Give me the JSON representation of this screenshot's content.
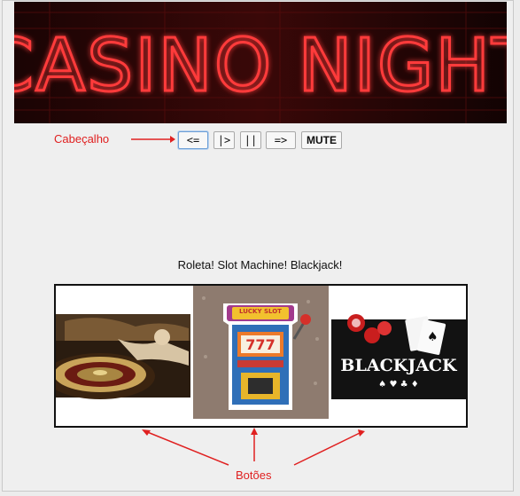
{
  "banner": {
    "title": "Casino Night",
    "logo_text": "CASINO NIGHT"
  },
  "annotations": {
    "header_label": "Cabeçalho",
    "buttons_label": "Botões"
  },
  "toolbar": {
    "prev_label": "<=",
    "play_label": "|>",
    "pause_label": "||",
    "next_label": "=>",
    "mute_label": "MUTE"
  },
  "caption": "Roleta! Slot Machine! Blackjack!",
  "games": [
    {
      "name": "Roleta",
      "icon": "roulette-image"
    },
    {
      "name": "Slot Machine",
      "icon": "slot-machine-image",
      "sign": "LUCKY SLOT",
      "reels": "777"
    },
    {
      "name": "Blackjack",
      "icon": "blackjack-image",
      "logo_text": "BLACKJACK"
    }
  ],
  "colors": {
    "annotation": "#e02020",
    "neon": "#ff2a2a",
    "focus": "#6d9fd6"
  }
}
